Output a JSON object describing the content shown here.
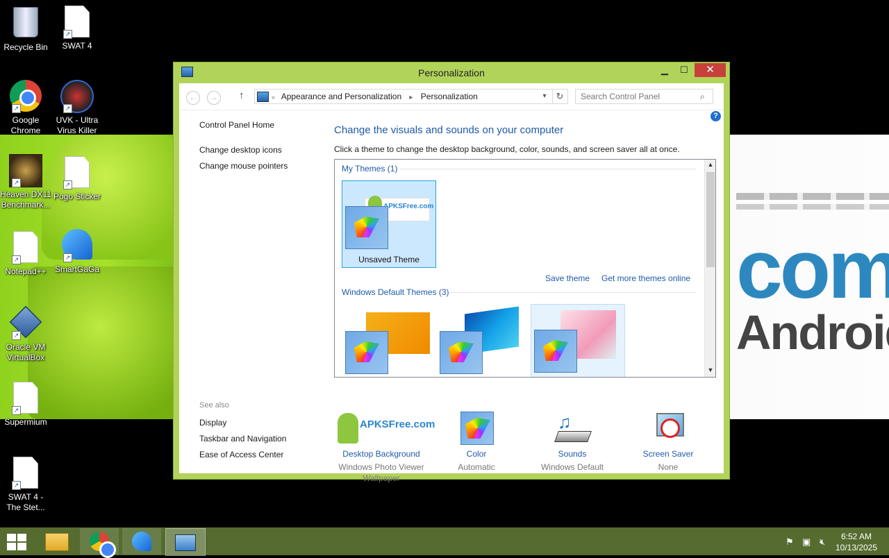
{
  "desktop": {
    "icons": [
      {
        "label": "Recycle Bin",
        "icon": "recycle-bin-icon"
      },
      {
        "label": "SWAT 4",
        "icon": "file-shortcut-icon"
      },
      {
        "label": "Google Chrome",
        "icon": "chrome-icon"
      },
      {
        "label": "UVK - Ultra Virus Killer",
        "icon": "uvk-icon"
      },
      {
        "label": "Heaven DX11 Benchmark...",
        "icon": "heaven-icon"
      },
      {
        "label": "Pogo Sticker",
        "icon": "file-shortcut-icon"
      },
      {
        "label": "Notepad++",
        "icon": "file-shortcut-icon"
      },
      {
        "label": "SmartGaGa",
        "icon": "smartgaga-icon"
      },
      {
        "label": "Oracle VM VirtualBox",
        "icon": "virtualbox-icon"
      },
      {
        "label": "Supermium",
        "icon": "file-shortcut-icon"
      },
      {
        "label": "SWAT 4 - The Stet...",
        "icon": "file-shortcut-icon"
      }
    ],
    "wallpaper": {
      "text_com": "com",
      "text_android": "Android™"
    }
  },
  "window": {
    "title": "Personalization",
    "controls": {
      "minimize": "▁",
      "maximize": "☐",
      "close": "✕"
    },
    "address": {
      "crumbs": [
        "«",
        "Appearance and Personalization",
        "Personalization"
      ]
    },
    "search": {
      "placeholder": "Search Control Panel"
    }
  },
  "left": {
    "home": "Control Panel Home",
    "links": [
      "Change desktop icons",
      "Change mouse pointers"
    ],
    "see_also_title": "See also",
    "see_also": [
      "Display",
      "Taskbar and Navigation",
      "Ease of Access Center"
    ]
  },
  "main": {
    "heading": "Change the visuals and sounds on your computer",
    "subtitle": "Click a theme to change the desktop background, color, sounds, and screen saver all at once.",
    "my_themes": {
      "title": "My Themes (1)",
      "themes": [
        {
          "name": "Unsaved Theme",
          "preview_text": "APKSFree.com"
        }
      ]
    },
    "links": {
      "save": "Save theme",
      "more": "Get more themes online"
    },
    "default_themes": {
      "title": "Windows Default Themes (3)"
    }
  },
  "bottom": [
    {
      "title": "Desktop Background",
      "sub": "Windows Photo Viewer Wallpaper",
      "preview": "APKSFree.com"
    },
    {
      "title": "Color",
      "sub": "Automatic"
    },
    {
      "title": "Sounds",
      "sub": "Windows Default"
    },
    {
      "title": "Screen Saver",
      "sub": "None"
    }
  ],
  "taskbar": {
    "time": "6:52 AM",
    "date": "10/13/2025",
    "color": "#556b2f"
  }
}
